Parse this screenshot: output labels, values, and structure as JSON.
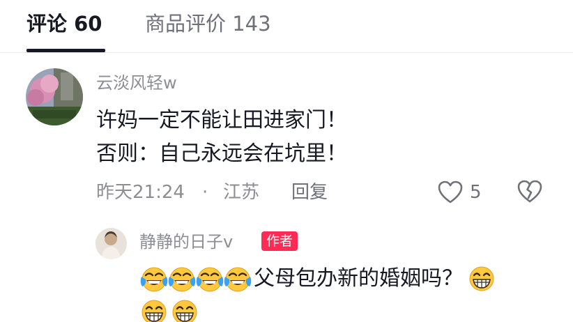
{
  "tabs": [
    {
      "label": "评论 60",
      "active": true
    },
    {
      "label": "商品评价 143",
      "active": false
    }
  ],
  "comment": {
    "username": "云淡风轻w",
    "lines": [
      "许妈一定不能让田进家门！",
      "否则：自己永远会在坑里！"
    ],
    "time": "昨天21:24",
    "separator": "·",
    "location": "江苏",
    "reply_label": "回复",
    "like_count": "5",
    "icons": {
      "like": "heart-outline-icon",
      "dislike": "broken-heart-icon"
    }
  },
  "reply": {
    "username": "静静的日子v",
    "badge": "作者",
    "text": "父母包办新的婚姻吗？",
    "leading_emojis": [
      "laugh-cry-emoji",
      "laugh-cry-emoji",
      "laugh-cry-emoji",
      "laugh-cry-emoji"
    ],
    "trailing_emojis": [
      "grin-emoji",
      "grin-emoji",
      "grin-emoji"
    ]
  },
  "colors": {
    "text_primary": "#161823",
    "text_secondary": "#8d8e94",
    "badge_bg": "#fe2c55",
    "emoji_yellow": "#ffc83d",
    "tear_blue": "#3aa0f0"
  }
}
